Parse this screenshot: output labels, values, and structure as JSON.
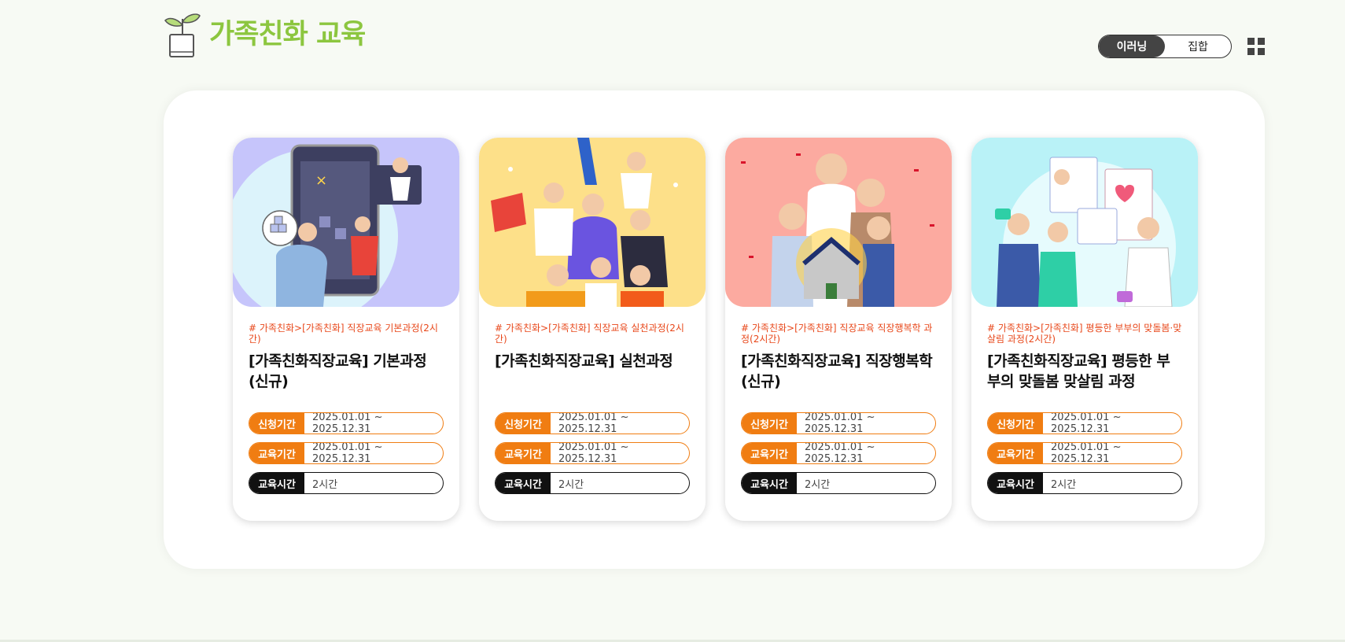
{
  "header": {
    "title": "가족친화 교육",
    "logo_icon": "plant-pot-icon",
    "toggle": [
      "이러닝",
      "집합"
    ],
    "active_toggle": "이러닝",
    "menu_icon": "grid-menu-icon"
  },
  "colors": {
    "brand_green": "#8cc63f",
    "orange": "#f07d12",
    "tag_red": "#e8471a",
    "dark": "#111111"
  },
  "labels": {
    "apply": "신청기간",
    "edu": "교육기간",
    "hours": "교육시간"
  },
  "courses": [
    {
      "tag": "# 가족친화>[가족친화] 직장교육 기본과정(2시간)",
      "title": "[가족친화직장교육] 기본과정 (신규)",
      "apply_period": "2025.01.01 ~ 2025.12.31",
      "edu_period": "2025.01.01 ~ 2025.12.31",
      "hours": "2시간",
      "thumb_bg": "#c6c5fb"
    },
    {
      "tag": "# 가족친화>[가족친화] 직장교육 실천과정(2시간)",
      "title": "[가족친화직장교육] 실천과정",
      "apply_period": "2025.01.01 ~ 2025.12.31",
      "edu_period": "2025.01.01 ~ 2025.12.31",
      "hours": "2시간",
      "thumb_bg": "#fde089"
    },
    {
      "tag": "# 가족친화>[가족친화] 직장교육 직장행복학 과정(2시간)",
      "title": "[가족친화직장교육] 직장행복학 (신규)",
      "apply_period": "2025.01.01 ~ 2025.12.31",
      "edu_period": "2025.01.01 ~ 2025.12.31",
      "hours": "2시간",
      "thumb_bg": "#fcaaa0"
    },
    {
      "tag": "# 가족친화>[가족친화] 평등한 부부의 맞돌봄·맞살림 과정(2시간)",
      "title": "[가족친화직장교육] 평등한 부부의 맞돌봄 맞살림 과정",
      "apply_period": "2025.01.01 ~ 2025.12.31",
      "edu_period": "2025.01.01 ~ 2025.12.31",
      "hours": "2시간",
      "thumb_bg": "#b9f2f7"
    }
  ]
}
